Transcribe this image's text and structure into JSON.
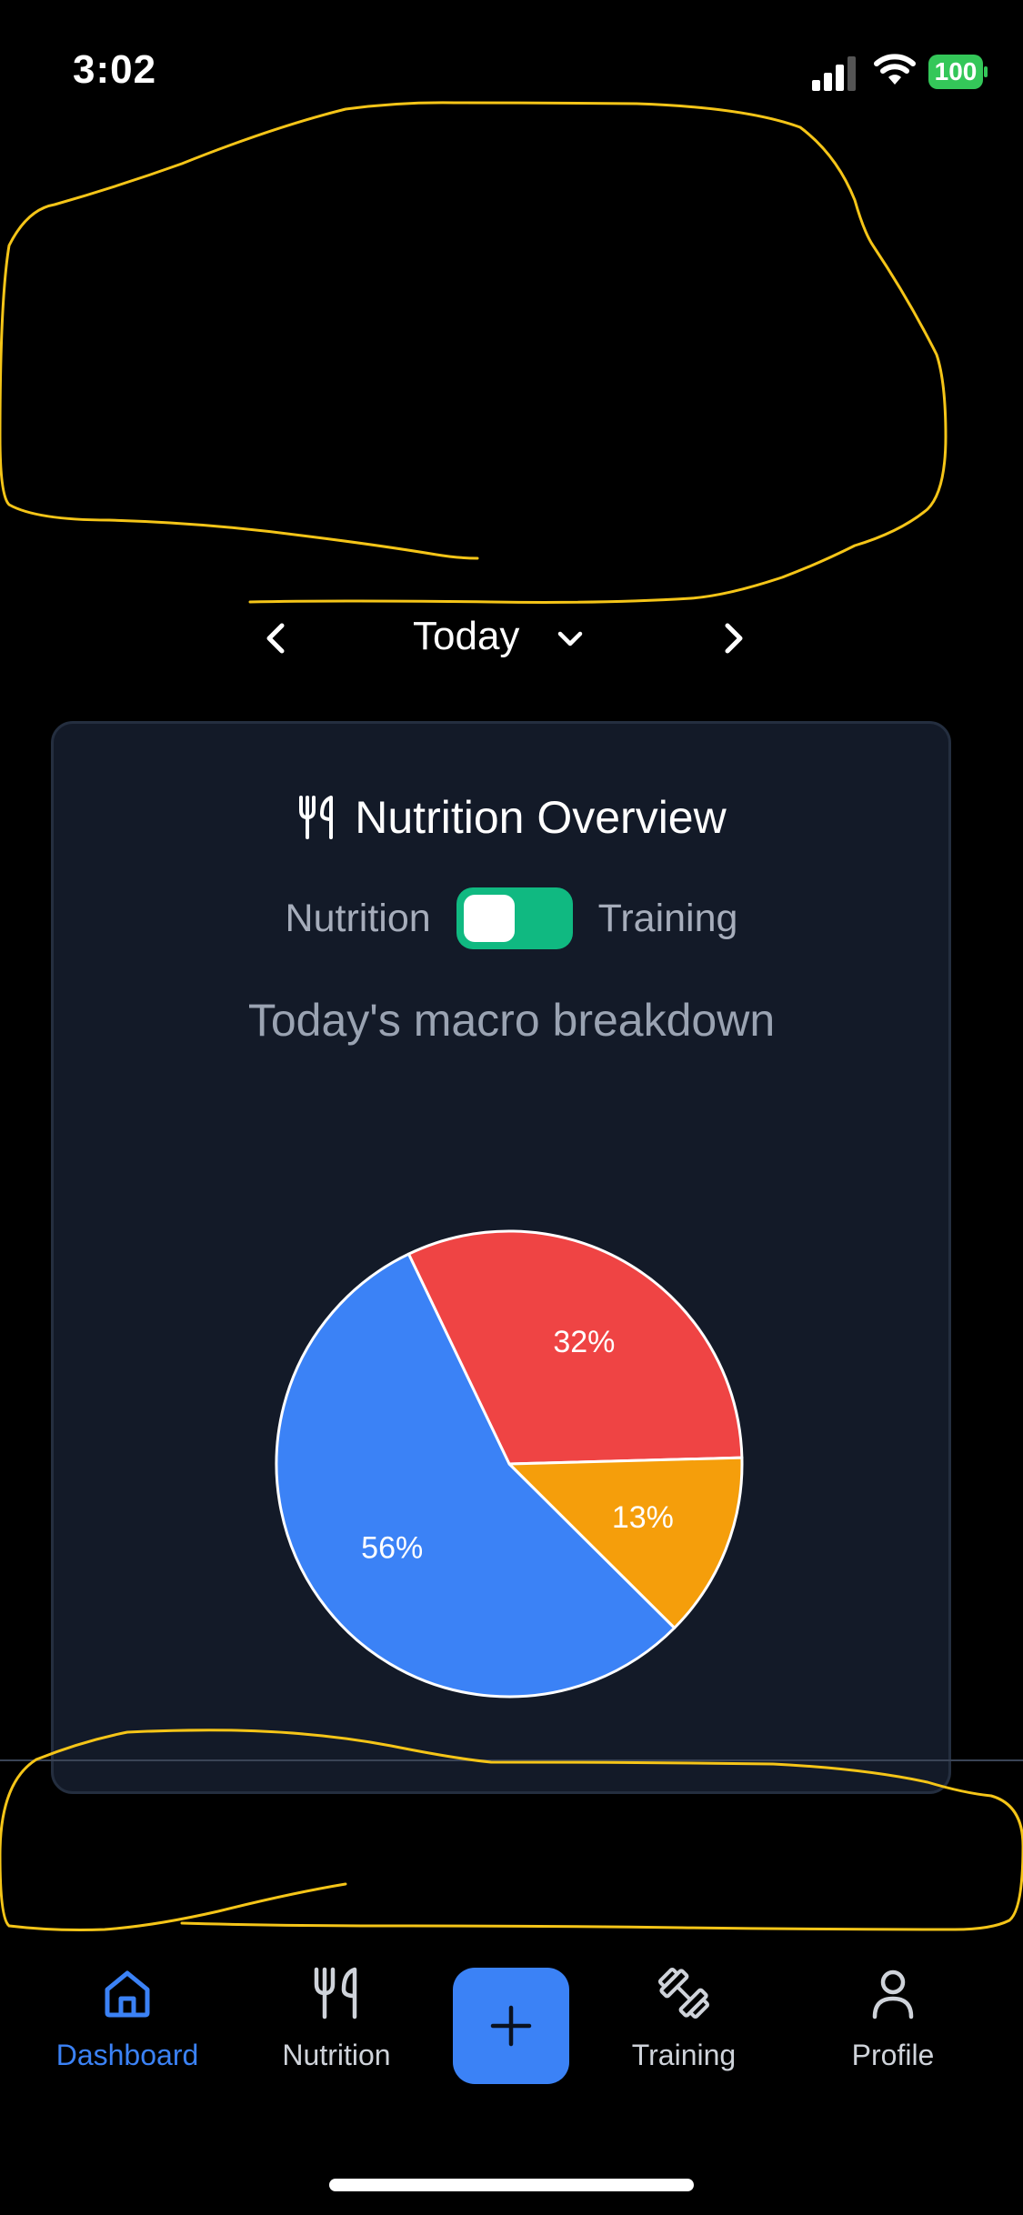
{
  "status_bar": {
    "time": "3:02",
    "battery": "100"
  },
  "date_nav": {
    "label": "Today"
  },
  "card": {
    "title": "Nutrition Overview",
    "toggle_left_label": "Nutrition",
    "toggle_right_label": "Training",
    "subtitle": "Today's macro breakdown"
  },
  "tabs": {
    "dashboard": "Dashboard",
    "nutrition": "Nutrition",
    "training": "Training",
    "profile": "Profile"
  },
  "colors": {
    "accent": "#3b82f6",
    "toggle_on": "#10b981",
    "slice_red": "#ef4444",
    "slice_orange": "#f59e0b",
    "slice_blue": "#3b82f6"
  },
  "chart_data": {
    "type": "pie",
    "title": "",
    "slices": [
      {
        "value": 32,
        "label": "32%",
        "color": "#ef4444"
      },
      {
        "value": 13,
        "label": "13%",
        "color": "#f59e0b"
      },
      {
        "value": 56,
        "label": "56%",
        "color": "#3b82f6"
      }
    ],
    "start_angle_deg": -115.6,
    "direction": "clockwise"
  }
}
